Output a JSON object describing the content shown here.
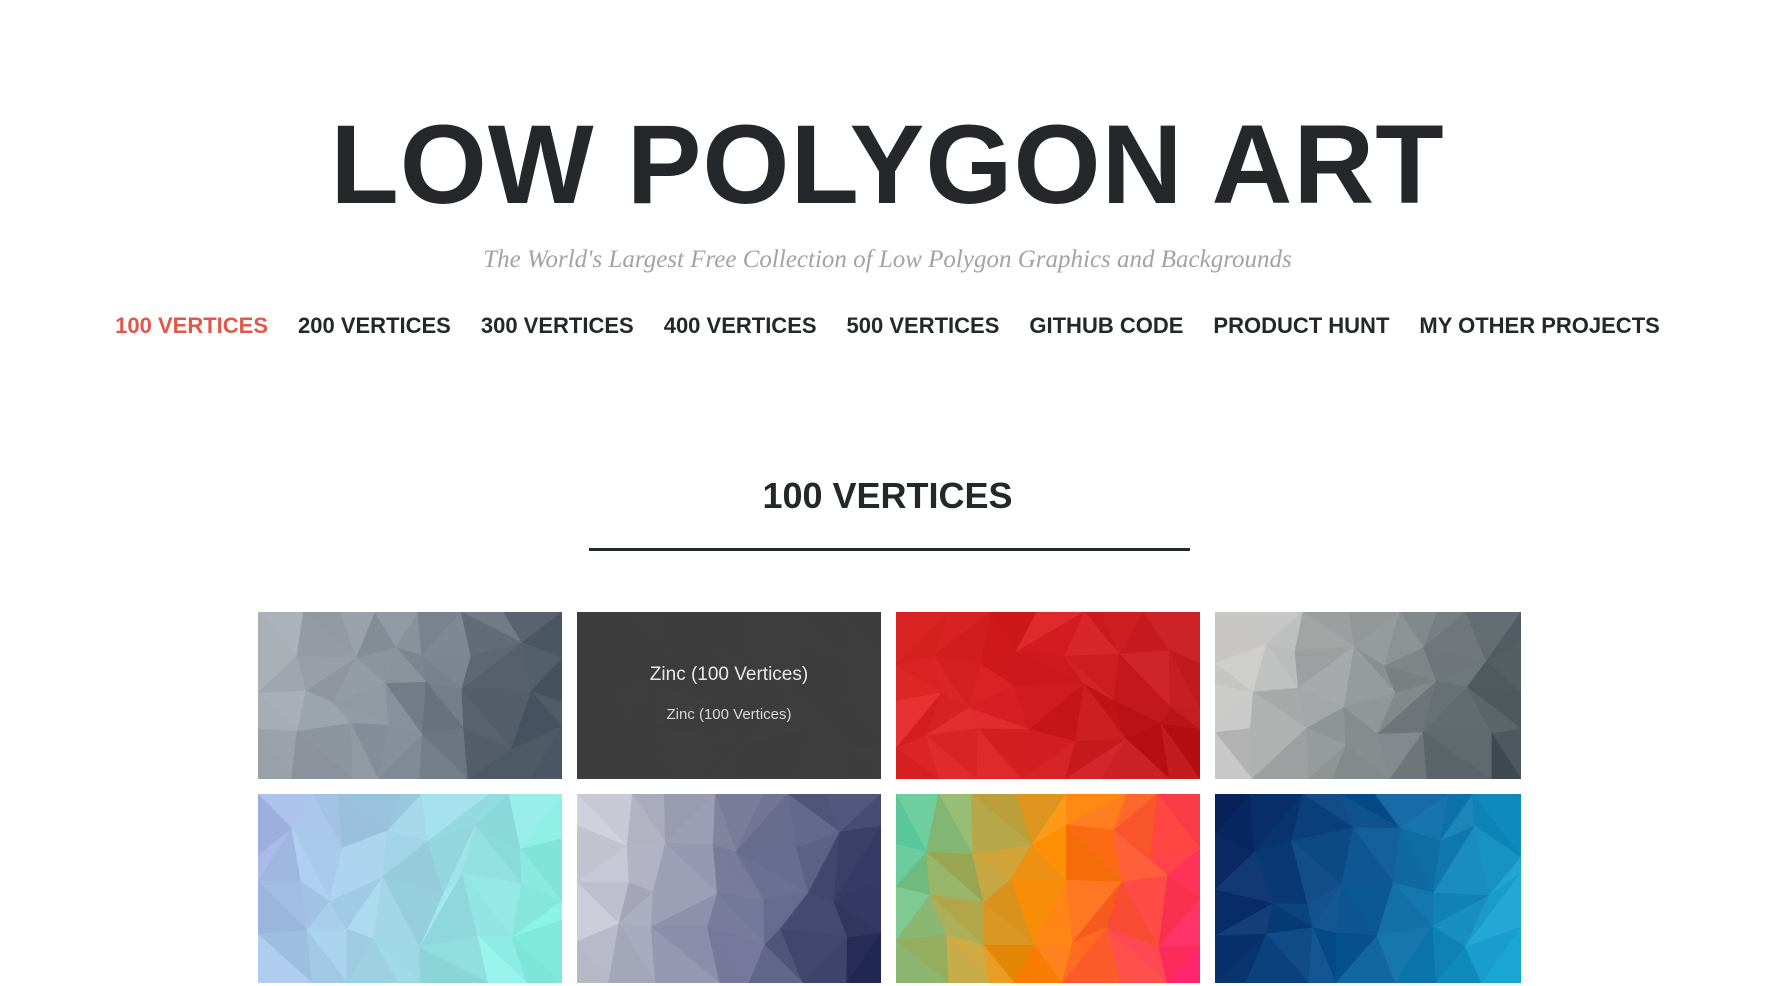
{
  "header": {
    "title": "LOW POLYGON ART",
    "tagline": "The World's Largest Free Collection of Low Polygon Graphics and Backgrounds"
  },
  "nav": {
    "items": [
      {
        "label": "100 VERTICES",
        "active": true
      },
      {
        "label": "200 VERTICES",
        "active": false
      },
      {
        "label": "300 VERTICES",
        "active": false
      },
      {
        "label": "400 VERTICES",
        "active": false
      },
      {
        "label": "500 VERTICES",
        "active": false
      },
      {
        "label": "GITHUB CODE",
        "active": false
      },
      {
        "label": "PRODUCT HUNT",
        "active": false
      },
      {
        "label": "MY OTHER PROJECTS",
        "active": false
      }
    ],
    "active_color": "#e0584a",
    "text_color": "#25282b"
  },
  "section": {
    "title": "100 VERTICES"
  },
  "gallery": {
    "items": [
      {
        "colors": [
          "#b3b8be",
          "#7d8791",
          "#3e4a58"
        ],
        "hover": false
      },
      {
        "colors": [
          "#3a3a3a",
          "#444444",
          "#4a4a4a"
        ],
        "hover": true,
        "title": "Zinc (100 Vertices)",
        "subtitle": "Zinc (100 Vertices)"
      },
      {
        "colors": [
          "#e02a2a",
          "#d41f22",
          "#b8151a"
        ],
        "hover": false
      },
      {
        "colors": [
          "#d8d6d4",
          "#8c9293",
          "#3f4b52"
        ],
        "hover": false
      },
      {
        "colors": [
          "#a9b6e8",
          "#9fd6e4",
          "#82f3e2"
        ],
        "hover": false
      },
      {
        "colors": [
          "#dcdde2",
          "#7e81a0",
          "#1d2350"
        ],
        "hover": false
      },
      {
        "colors": [
          "#4bd4b6",
          "#ff8a00",
          "#ff1a72"
        ],
        "hover": false
      },
      {
        "colors": [
          "#0a1f57",
          "#0d5896",
          "#1bb0da"
        ],
        "hover": false
      }
    ]
  }
}
